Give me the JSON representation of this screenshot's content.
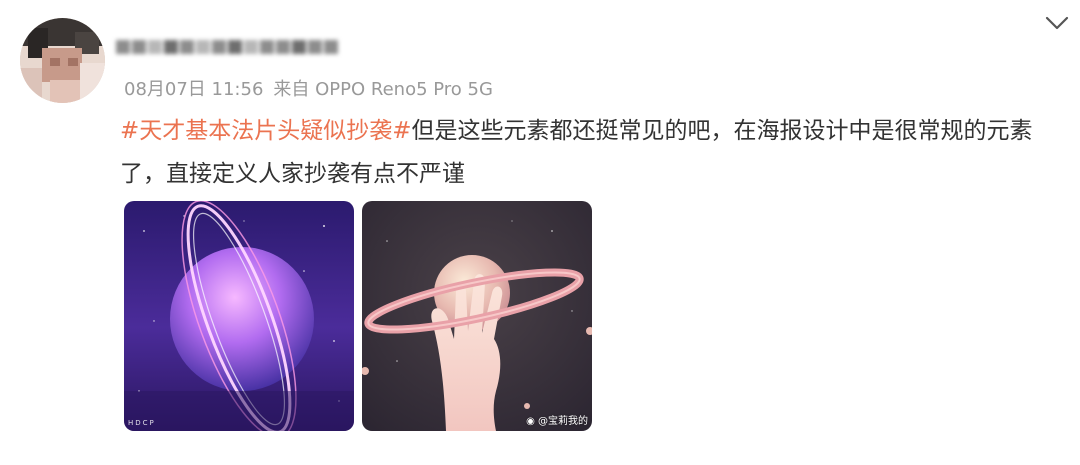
{
  "post": {
    "meta": {
      "time": "08月07日 11:56",
      "source": "来自 OPPO Reno5 Pro 5G"
    },
    "content": {
      "hashtag": "#天才基本法片头疑似抄袭#",
      "text": "但是这些元素都还挺常见的吧，在海报设计中是很常规的元素了，直接定义人家抄袭有点不严谨"
    },
    "images": [
      {
        "corner_text": "HDCP"
      },
      {
        "watermark": "@宝莉我的"
      }
    ],
    "icons": {
      "expand": "chevron-down-icon",
      "weibo": "weibo-logo-icon"
    },
    "colors": {
      "hashtag": "#eb7350",
      "meta": "#999999",
      "text": "#333333"
    }
  }
}
